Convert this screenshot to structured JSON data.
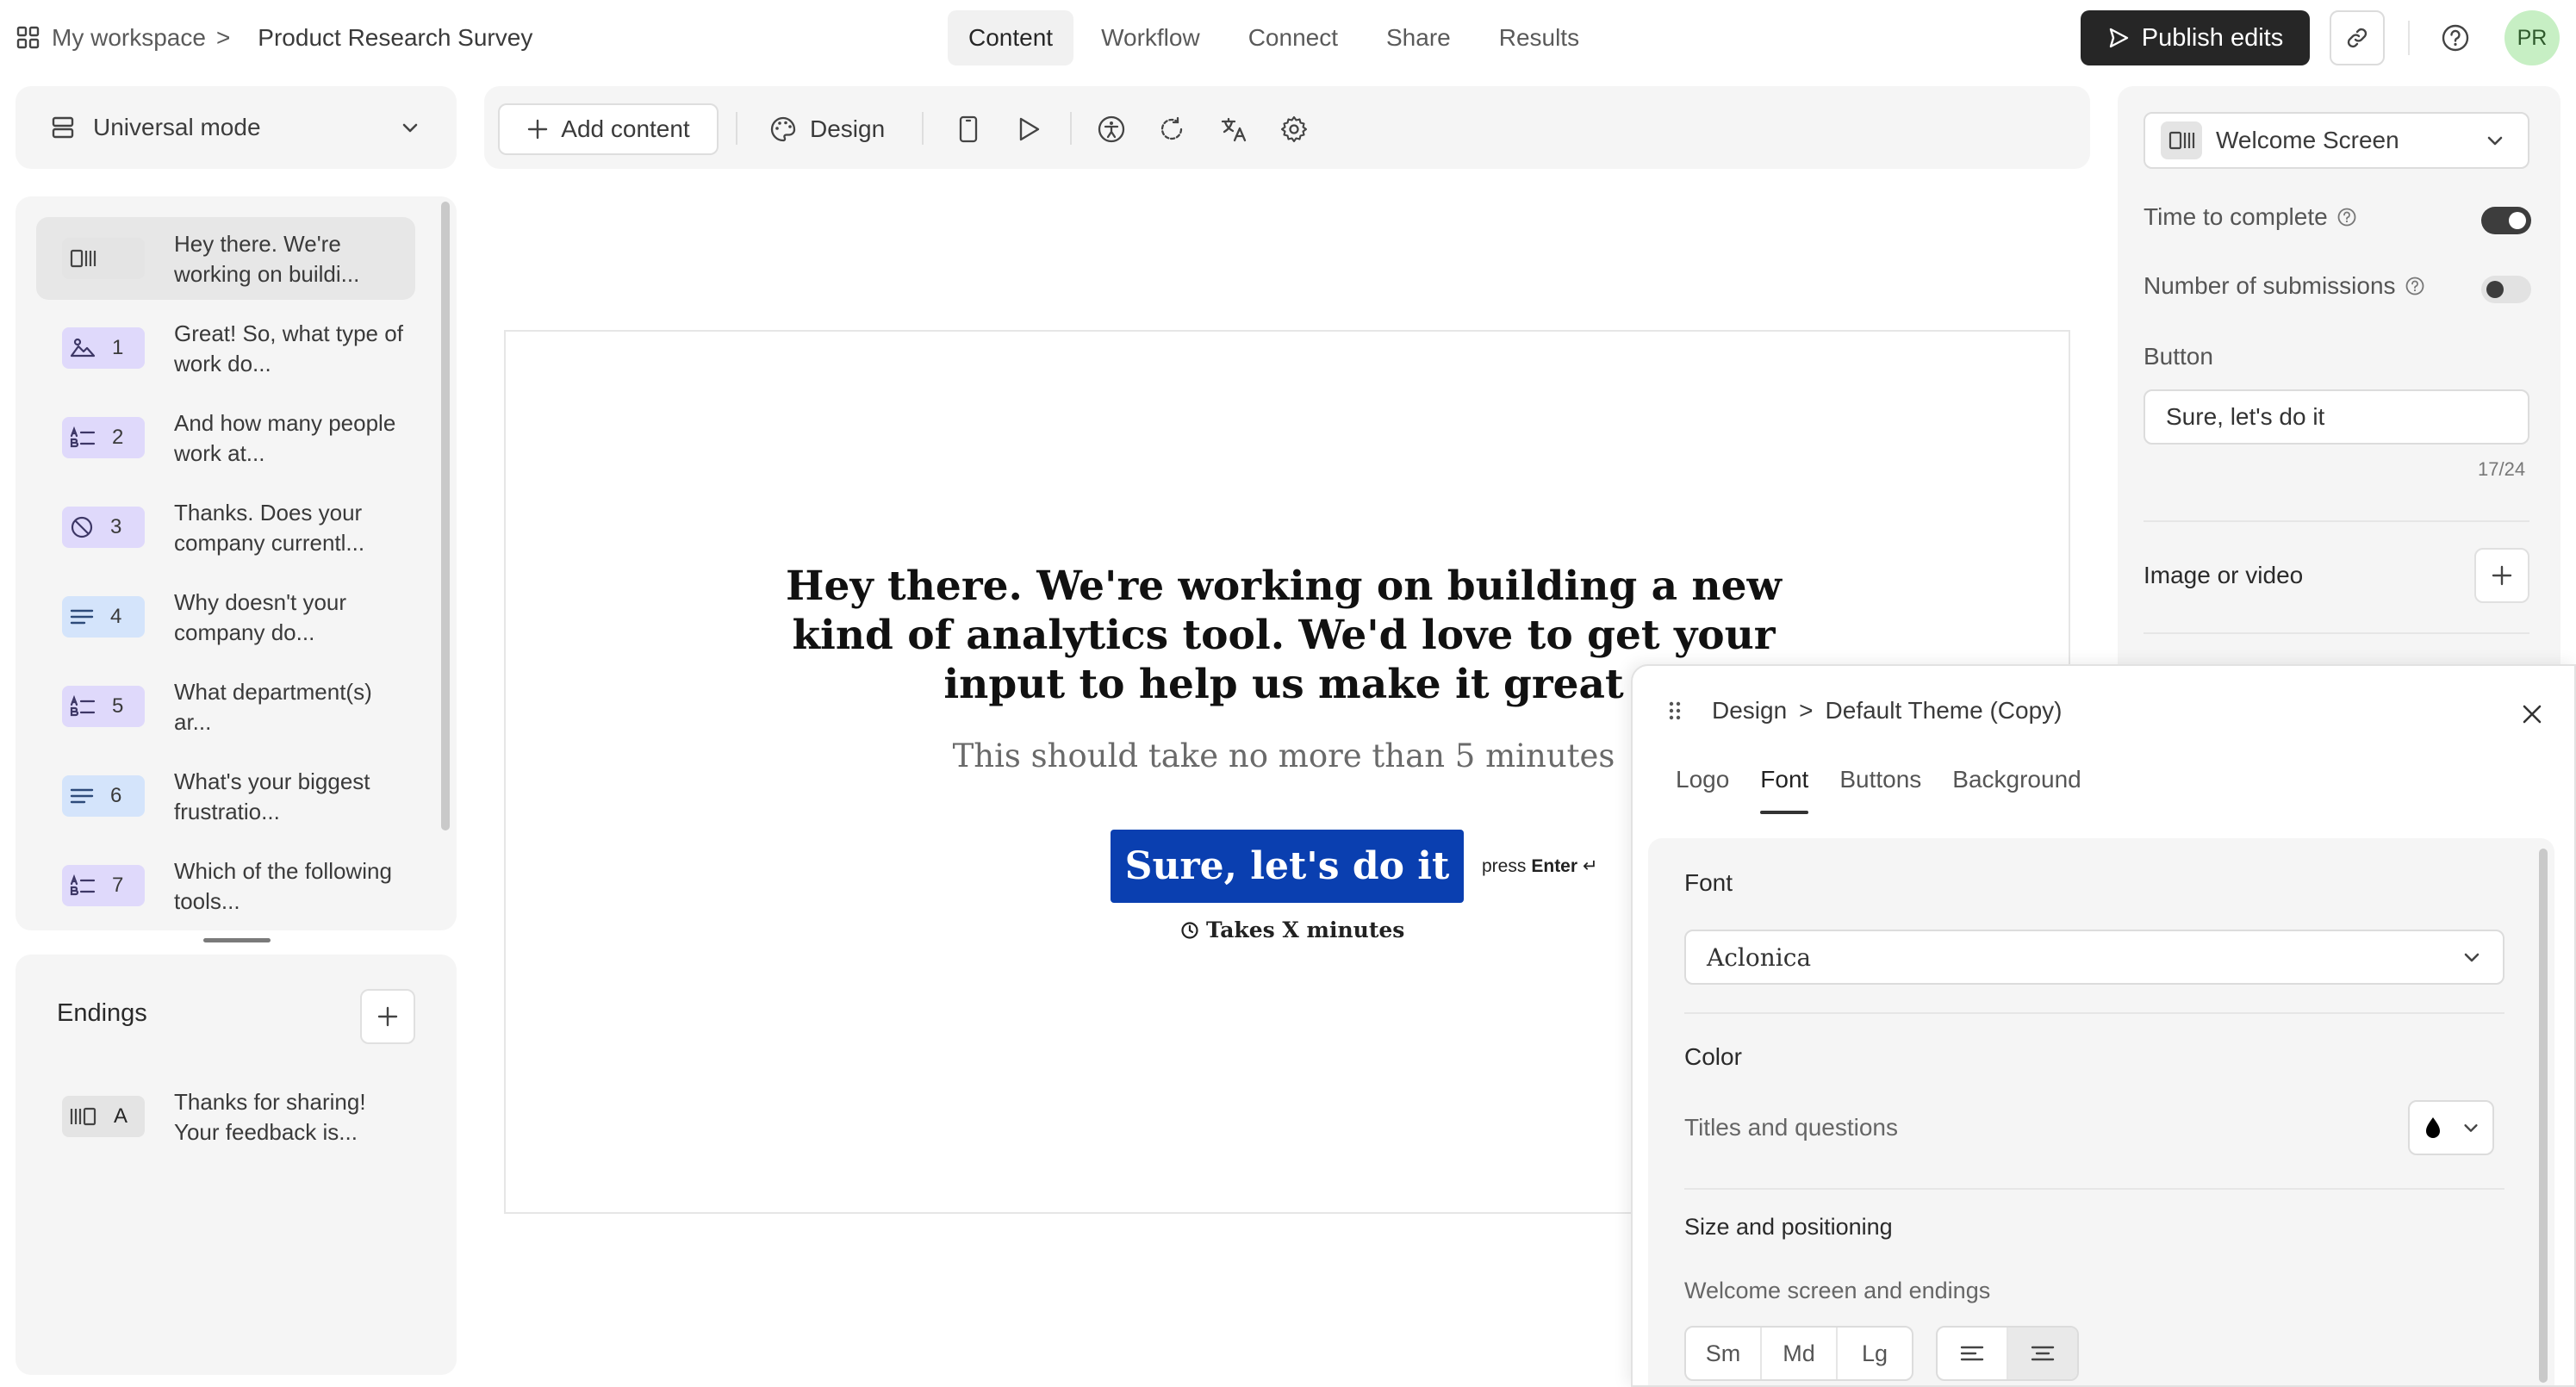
{
  "breadcrumb": {
    "workspace": "My workspace",
    "separator": ">",
    "survey": "Product Research Survey"
  },
  "nav": {
    "tabs": [
      "Content",
      "Workflow",
      "Connect",
      "Share",
      "Results"
    ],
    "active": "Content"
  },
  "header": {
    "publish_label": "Publish edits",
    "avatar_initials": "PR"
  },
  "sidebar": {
    "mode_label": "Universal mode",
    "questions": [
      {
        "num": "",
        "icon": "welcome-screen-icon",
        "text": "Hey there. We're working on buildi...",
        "color": "#e4e4e4"
      },
      {
        "num": "1",
        "icon": "picture-choice-icon",
        "text": "Great! So, what type of work do...",
        "color": "#dfd9fb"
      },
      {
        "num": "2",
        "icon": "multiple-choice-icon",
        "text": "And how many people work at...",
        "color": "#dfd9fb"
      },
      {
        "num": "3",
        "icon": "yes-no-icon",
        "text": "Thanks. Does your company currentl...",
        "color": "#dfd9fb"
      },
      {
        "num": "4",
        "icon": "long-text-icon",
        "text": "Why doesn't your company do...",
        "color": "#d4e4fb"
      },
      {
        "num": "5",
        "icon": "multiple-choice-icon",
        "text": "What department(s) ar...",
        "color": "#dfd9fb"
      },
      {
        "num": "6",
        "icon": "long-text-icon",
        "text": "What's your biggest frustratio...",
        "color": "#d4e4fb"
      },
      {
        "num": "7",
        "icon": "multiple-choice-icon",
        "text": "Which of the following tools...",
        "color": "#dfd9fb"
      }
    ],
    "endings_title": "Endings",
    "endings": [
      {
        "num": "A",
        "icon": "ending-icon",
        "text": "Thanks for sharing! Your feedback is..."
      }
    ]
  },
  "toolbar": {
    "add_content_label": "Add content",
    "design_label": "Design"
  },
  "preview": {
    "title": "Hey there. We're working on building a new kind of analytics tool. We'd love to get your input to help us make it great",
    "subtitle": "This should take no more than 5 minutes",
    "button_label": "Sure, let's do it",
    "press_text": "press",
    "press_key": "Enter",
    "press_glyph": "↵",
    "takes_label": "Takes X minutes",
    "button_color": "#0a3fb0"
  },
  "settings": {
    "screen_type": "Welcome Screen",
    "time_to_complete_label": "Time to complete",
    "time_to_complete_on": true,
    "submissions_label": "Number of submissions",
    "submissions_on": false,
    "button_section_label": "Button",
    "button_value": "Sure, let's do it",
    "button_count": "17/24",
    "image_or_video_label": "Image or video"
  },
  "design_panel": {
    "breadcrumb_root": "Design",
    "separator": ">",
    "theme_name": "Default Theme (Copy)",
    "tabs": [
      "Logo",
      "Font",
      "Buttons",
      "Background"
    ],
    "active_tab": "Font",
    "font_section": "Font",
    "font_value": "Aclonica",
    "color_section": "Color",
    "titles_questions_label": "Titles and questions",
    "titles_color": "#000000",
    "size_section": "Size and positioning",
    "welcome_endings_label": "Welcome screen and endings",
    "size_options": [
      "Sm",
      "Md",
      "Lg"
    ],
    "selected_size": "Lg",
    "alignment_options": [
      "align-left-icon",
      "align-center-icon"
    ],
    "selected_alignment": "align-center-icon"
  }
}
